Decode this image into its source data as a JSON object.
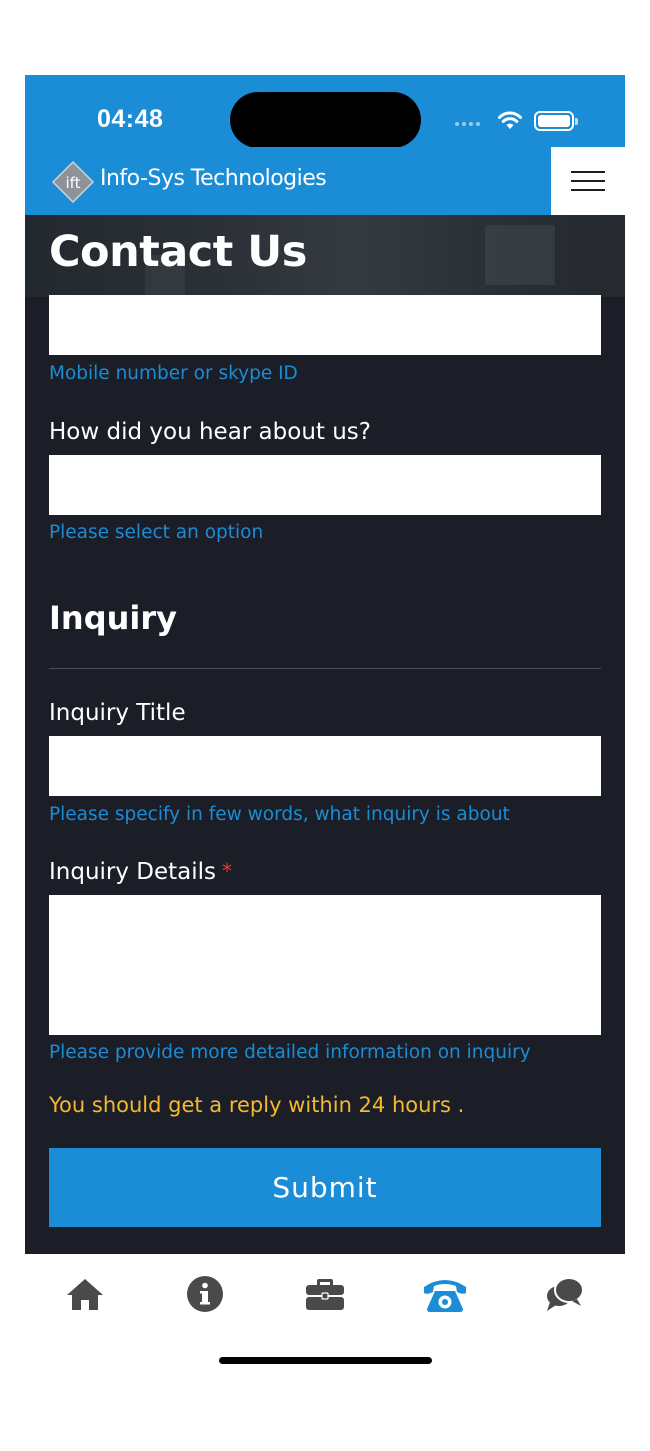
{
  "status_bar": {
    "time": "04:48"
  },
  "header": {
    "brand_name": "Info-Sys Technologies",
    "logo_text": "ift"
  },
  "page": {
    "title": "Contact Us"
  },
  "form": {
    "contact_field": {
      "value": "",
      "hint": "Mobile number or skype ID"
    },
    "hear_about": {
      "label": "How did you hear about us?",
      "value": "",
      "hint": "Please select an option"
    },
    "section_heading": "Inquiry",
    "inquiry_title": {
      "label": "Inquiry Title",
      "value": "",
      "hint": "Please specify in few words, what inquiry is about"
    },
    "inquiry_details": {
      "label": "Inquiry Details",
      "required_mark": "*",
      "value": "",
      "hint": "Please provide more detailed information on inquiry"
    },
    "reply_note": "You should get a reply within 24 hours .",
    "submit_label": "Submit"
  },
  "tab_bar": {
    "items": [
      {
        "icon": "home-icon",
        "active": false
      },
      {
        "icon": "info-icon",
        "active": false
      },
      {
        "icon": "briefcase-icon",
        "active": false
      },
      {
        "icon": "phone-icon",
        "active": true
      },
      {
        "icon": "chat-icon",
        "active": false
      }
    ]
  },
  "colors": {
    "primary": "#1b8cd6",
    "background": "#1b1e27",
    "hint": "#1b8cd6",
    "reply_note": "#f5b82e",
    "tab_inactive": "#4a4a4a",
    "required": "#e53935"
  }
}
